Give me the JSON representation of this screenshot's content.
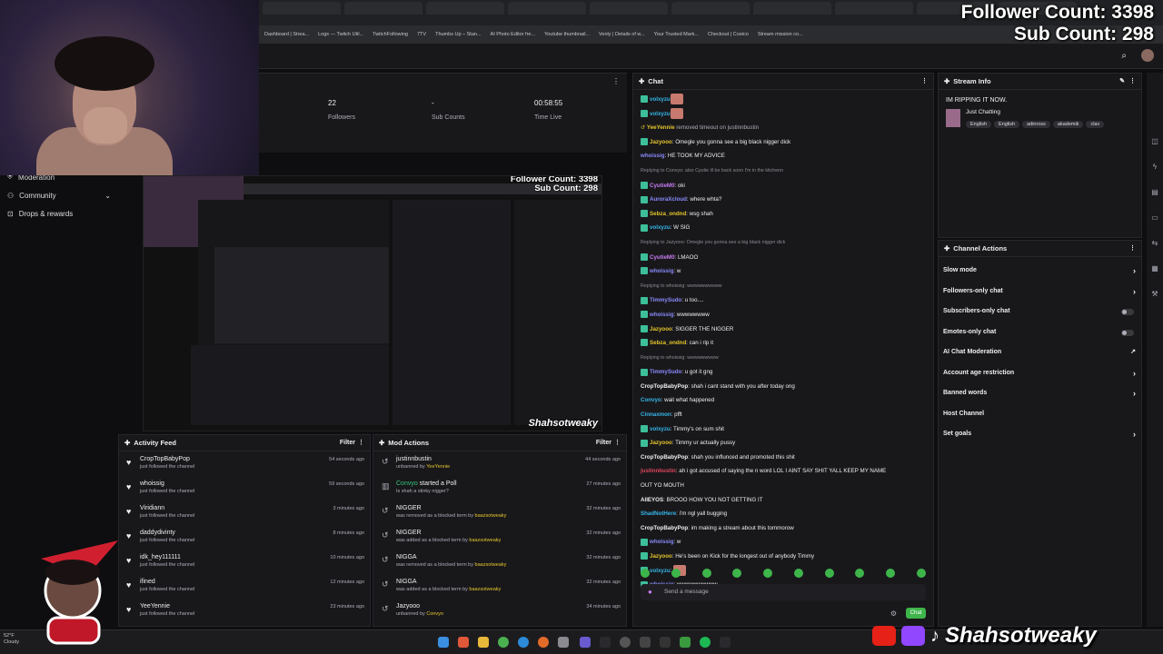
{
  "overlay": {
    "follower_count": "Follower Count: 3398",
    "sub_count": "Sub Count: 298",
    "brand_handle": "Shahsotweaky",
    "preview_follower": "Follower Count: 3398",
    "preview_sub": "Sub Count: 298",
    "preview_handle": "Shahsotweaky"
  },
  "bookmarks": [
    "Dashboard | Strea...",
    "Logs — Twitch Util...",
    "TwitchFollowing",
    "7TV",
    "Thumbs Up – Stan...",
    "AI Photo Editor fre...",
    "Youtube thumbnail...",
    "Venly | Details of w...",
    "Your Trusted Mark...",
    "Checkout | Costco",
    "Stream mission co..."
  ],
  "sidebar": {
    "items": [
      {
        "label": "Moderation"
      },
      {
        "label": "Community"
      },
      {
        "label": "Drops & rewards"
      }
    ]
  },
  "stats": [
    {
      "value": "22",
      "label": "Followers"
    },
    {
      "value": "-",
      "label": "Sub Counts"
    },
    {
      "value": "00:58:55",
      "label": "Time Live"
    }
  ],
  "activity_feed": {
    "title": "Activity Feed",
    "filter": "Filter",
    "rows": [
      {
        "name": "CropTopBabyPop",
        "sub": "just followed the channel",
        "time": "54 seconds ago"
      },
      {
        "name": "whoissig",
        "sub": "just followed the channel",
        "time": "59 seconds ago"
      },
      {
        "name": "Viridiann",
        "sub": "just followed the channel",
        "time": "3 minutes ago"
      },
      {
        "name": "daddydivinty",
        "sub": "just followed the channel",
        "time": "8 minutes ago"
      },
      {
        "name": "idk_hey111111",
        "sub": "just followed the channel",
        "time": "10 minutes ago"
      },
      {
        "name": "ifined",
        "sub": "just followed the channel",
        "time": "12 minutes ago"
      },
      {
        "name": "YeeYennie",
        "sub": "just followed the channel",
        "time": "23 minutes ago"
      }
    ]
  },
  "mod_actions": {
    "title": "Mod Actions",
    "filter": "Filter",
    "rows": [
      {
        "name": "justinnbustin",
        "sub_prefix": "unbanned by",
        "sub_user": "YeeYennie",
        "time": "44 seconds ago"
      },
      {
        "name": "Convyo",
        "name_suffix": " started a Poll",
        "sub_prefix": "Is shah a stinky nigger?",
        "sub_user": "",
        "time": "27 minutes ago"
      },
      {
        "name": "NIGGER",
        "sub_prefix": "was removed as a blocked term by",
        "sub_user": "baazsotweaky",
        "time": "32 minutes ago"
      },
      {
        "name": "NIGGER",
        "sub_prefix": "was added as a blocked term by",
        "sub_user": "baazsotweaky",
        "time": "32 minutes ago"
      },
      {
        "name": "NIGGA",
        "sub_prefix": "was removed as a blocked term by",
        "sub_user": "baazsotweaky",
        "time": "32 minutes ago"
      },
      {
        "name": "NIGGA",
        "sub_prefix": "was added as a blocked term by",
        "sub_user": "baazsotweaky",
        "time": "32 minutes ago"
      },
      {
        "name": "Jazyooo",
        "sub_prefix": "unbanned by",
        "sub_user": "Convyo",
        "time": "34 minutes ago"
      }
    ]
  },
  "chat": {
    "title": "Chat",
    "placeholder": "Send a message",
    "send": "Chat",
    "messages": [
      {
        "user": "volxyzu",
        "color": "#35b5e8",
        "text": "",
        "emote": true,
        "badge": true
      },
      {
        "user": "volxyzu",
        "color": "#35b5e8",
        "text": "",
        "emote": true,
        "badge": true
      },
      {
        "user": "YeeYennie",
        "color": "#e5c62a",
        "text": " removed timeout on justinnbustin",
        "system": true
      },
      {
        "user": "Jazyooo",
        "color": "#e5c62a",
        "text": ": Omegle you gonna see a big black nigger dick",
        "badge": true
      },
      {
        "user": "whoissig",
        "color": "#8a8afc",
        "text": ": HE TOOK MY ADVICE"
      },
      {
        "reply": "Replying to Convyo: also Cyutie ill be back soon I'm in the kitchenn"
      },
      {
        "user": "CyutieM0",
        "color": "#c77df0",
        "text": ": oki",
        "badge": true
      },
      {
        "user": "AuroraXcloud",
        "color": "#8a8afc",
        "text": ": where whta?",
        "badge": true
      },
      {
        "user": "Sebza_ondnd",
        "color": "#e5c62a",
        "text": ": wsg shah",
        "badge": true
      },
      {
        "user": "volxyzu",
        "color": "#35b5e8",
        "text": ": W SIG",
        "badge": true
      },
      {
        "reply": "Replying to Jazyooo: Omegle you gonna see a big black nigger dick"
      },
      {
        "user": "CyutieM0",
        "color": "#c77df0",
        "text": ": LMAOO",
        "badge": true
      },
      {
        "user": "whoissig",
        "color": "#8a8afc",
        "text": ": w",
        "badge": true
      },
      {
        "reply": "Replying to whoissig: wwwwwwwwww"
      },
      {
        "user": "TimmySudo",
        "color": "#8a8afc",
        "text": ": u too....",
        "badge": true
      },
      {
        "user": "whoissig",
        "color": "#8a8afc",
        "text": ": wwwwwwww",
        "badge": true
      },
      {
        "user": "Jazyooo",
        "color": "#e5c62a",
        "text": ": SIGGER THE NIGGER",
        "badge": true
      },
      {
        "user": "Sebza_ondnd",
        "color": "#e5c62a",
        "text": ": can i rip it",
        "badge": true
      },
      {
        "reply": "Replying to whoissig: wwwwwwwww"
      },
      {
        "user": "TimmySudo",
        "color": "#8a8afc",
        "text": ": u got it gng",
        "badge": true
      },
      {
        "user": "CropTopBabyPop",
        "color": "#efeff1",
        "text": ": shah i cant stand with you after today ong"
      },
      {
        "user": "Convyo",
        "color": "#35b5e8",
        "text": ": wait what happened"
      },
      {
        "user": "Cinnaxmon",
        "color": "#35b5e8",
        "text": ": pfft"
      },
      {
        "user": "volxyzu",
        "color": "#35b5e8",
        "text": ": Timmy's on sum shit",
        "badge": true
      },
      {
        "user": "Jazyooo",
        "color": "#e5c62a",
        "text": ": Timmy ur actually pussy",
        "badge": true
      },
      {
        "user": "CropTopBabyPop",
        "color": "#efeff1",
        "text": ": shah you influnced and promoted this shit"
      },
      {
        "user": "justinnbustin",
        "color": "#e0465a",
        "text": ": ah i got accused of saying the n word LOL I AINT SAY SHIT YALL KEEP MY NAME"
      },
      {
        "user": "",
        "color": "#efeff1",
        "text": "OUT YO MOUTH"
      },
      {
        "user": "AllEYOS",
        "color": "#efeff1",
        "text": ": BROOO HOW YOU NOT GETTING IT"
      },
      {
        "user": "ShadNotHere",
        "color": "#35b5e8",
        "text": ": i'm ngl yall bugging"
      },
      {
        "user": "CropTopBabyPop",
        "color": "#efeff1",
        "text": ": im making a stream about this tommorow"
      },
      {
        "user": "whoissig",
        "color": "#8a8afc",
        "text": ": w",
        "badge": true
      },
      {
        "user": "Jazyooo",
        "color": "#e5c62a",
        "text": ": He's been on Kick for the longest out of anybody Timmy",
        "badge": true
      },
      {
        "user": "volxyzu",
        "color": "#35b5e8",
        "text": ": ",
        "emote": true,
        "badge": true
      },
      {
        "user": "whoissig",
        "color": "#8a8afc",
        "text": ": wwwwwwwwww",
        "badge": true
      }
    ]
  },
  "stream_info": {
    "title": "Stream Info",
    "stream_title": "IM RIPPING IT NOW.",
    "category": "Just Chatting",
    "tags": [
      "English",
      "English",
      "adinross",
      "akademik",
      "clav"
    ]
  },
  "channel_actions": {
    "title": "Channel Actions",
    "rows": [
      {
        "label": "Slow mode",
        "ctl": "chevron"
      },
      {
        "label": "Followers-only chat",
        "ctl": "chevron"
      },
      {
        "label": "Subscribers-only chat",
        "ctl": "toggle"
      },
      {
        "label": "Emotes-only chat",
        "ctl": "toggle"
      },
      {
        "label": "AI Chat Moderation",
        "ctl": "external"
      },
      {
        "label": "Account age restriction",
        "ctl": "chevron"
      },
      {
        "label": "Banned words",
        "ctl": "chevron"
      },
      {
        "label": "Host Channel",
        "ctl": "none"
      },
      {
        "label": "Set goals",
        "ctl": "chevron"
      }
    ]
  },
  "weather": {
    "temp": "52°F",
    "cond": "Cloudy"
  },
  "colors": {
    "accent": "#3eb54a",
    "panel": "#18181b",
    "bg": "#0e0e10"
  }
}
